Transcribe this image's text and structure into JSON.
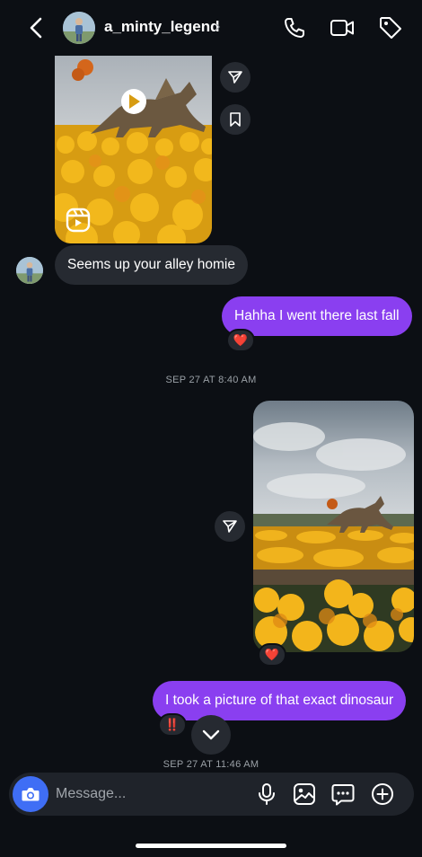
{
  "header": {
    "username": "a_minty_legend",
    "chevron": "›",
    "icons": [
      "back-chevron-icon",
      "phone-icon",
      "video-call-icon",
      "tag-icon"
    ]
  },
  "messages": [
    {
      "type": "shared-reel",
      "from": "them",
      "icons": [
        "play-icon",
        "reels-icon",
        "send-icon",
        "bookmark-icon"
      ]
    },
    {
      "type": "text",
      "from": "them",
      "text": "Seems up your alley homie"
    },
    {
      "type": "text",
      "from": "me",
      "text": "Hahha I went there last fall",
      "reaction": "❤️"
    },
    {
      "type": "timestamp",
      "text": "SEP 27 AT 8:40 AM"
    },
    {
      "type": "photo",
      "from": "me",
      "reaction": "❤️"
    },
    {
      "type": "text",
      "from": "me",
      "text": "I took a picture of that exact dinosaur",
      "reaction": "‼️"
    },
    {
      "type": "timestamp",
      "text": "SEP 27 AT 11:46 AM"
    }
  ],
  "composer": {
    "placeholder": "Message...",
    "icons": [
      "camera-icon",
      "microphone-icon",
      "gallery-icon",
      "sticker-icon",
      "plus-icon"
    ]
  },
  "colors": {
    "background": "#0c0f14",
    "incoming": "#262a31",
    "outgoing": "#8a3ff0",
    "camera": "#3f6ef5"
  }
}
